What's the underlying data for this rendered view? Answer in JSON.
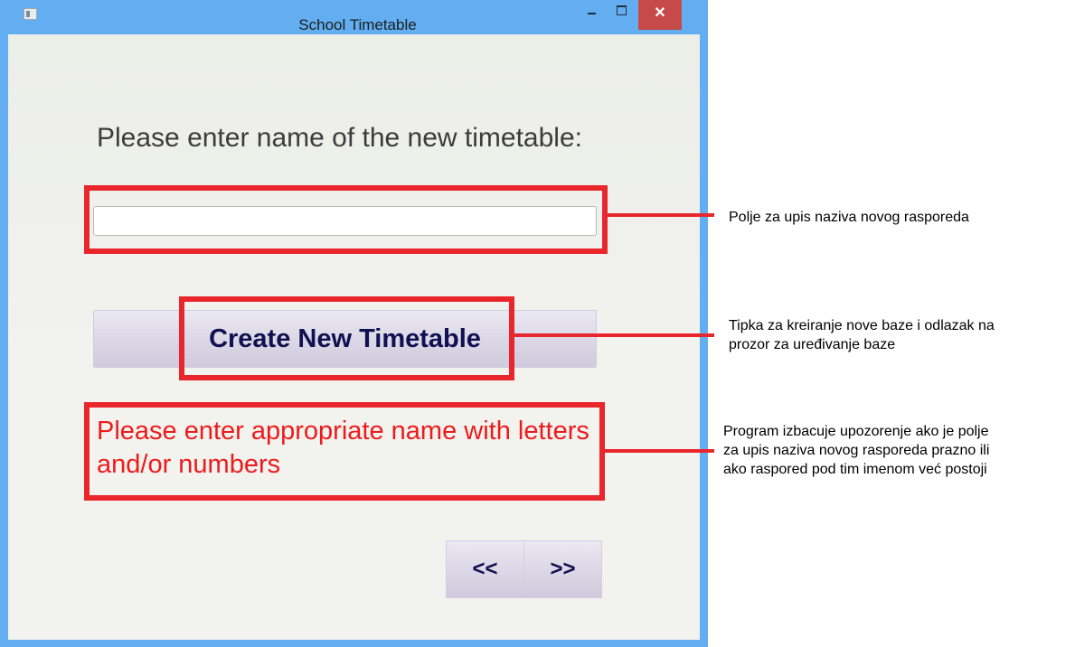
{
  "window": {
    "title": "School Timetable",
    "close_glyph": "✕",
    "icons": [
      "app-icon",
      "minimize-icon",
      "maximize-icon",
      "close-icon"
    ]
  },
  "form": {
    "prompt_label": "Please enter name of the new timetable:",
    "name_input": {
      "value": "",
      "placeholder": ""
    },
    "create_button_label": "Create New Timetable",
    "warning_message": "Please enter appropriate name with letters and/or numbers",
    "nav_prev_label": "<<",
    "nav_next_label": ">>"
  },
  "annotations": {
    "input_field_note": "Polje za upis naziva novog rasporeda",
    "create_button_note_line1": "Tipka za kreiranje nove baze i odlazak na",
    "create_button_note_line2": "prozor za uređivanje baze",
    "warning_note_line1": "Program izbacuje upozorenje ako je polje",
    "warning_note_line2": "za upis naziva novog rasporeda prazno ili",
    "warning_note_line3": "ako raspored pod tim imenom već postoji"
  },
  "colors": {
    "highlight": "#e8262c",
    "warning_text": "#ee1b1b",
    "button_text": "#0f1150",
    "window_frame": "#62aef0",
    "close_button": "#c74a4a"
  }
}
